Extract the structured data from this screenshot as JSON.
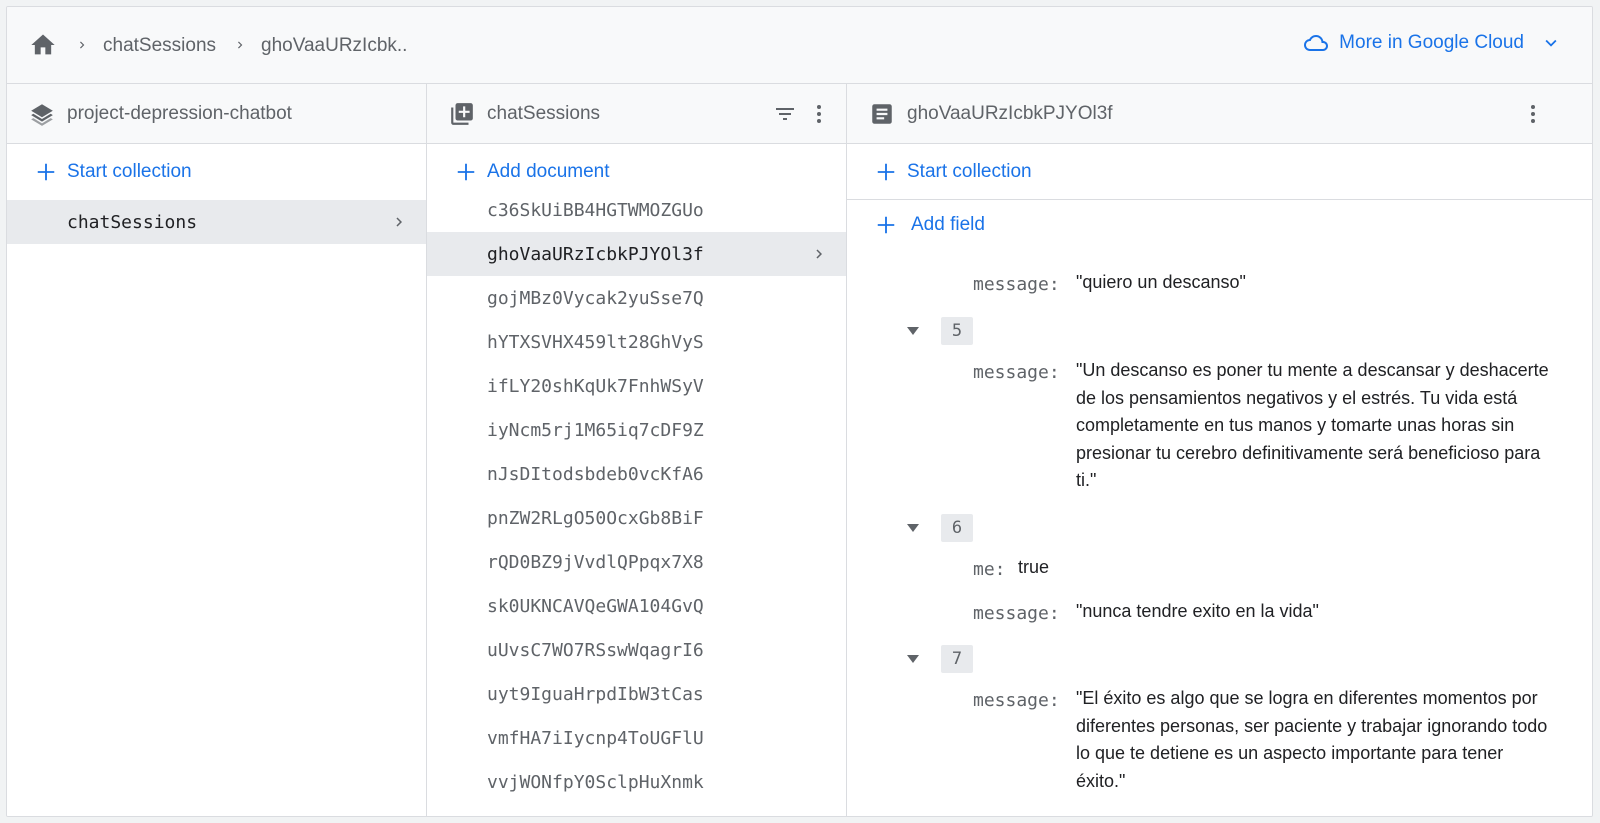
{
  "breadcrumb": {
    "items": [
      "chatSessions",
      "ghoVaaURzIcbk.."
    ],
    "gcloud_label": "More in Google Cloud"
  },
  "root_panel": {
    "title": "project-depression-chatbot",
    "action": "Start collection",
    "items": [
      "chatSessions"
    ]
  },
  "collection_panel": {
    "title": "chatSessions",
    "action": "Add document",
    "items": [
      "c36SkUiBB4HGTWMOZGUo",
      "ghoVaaURzIcbkPJYOl3f",
      "gojMBz0Vycak2yuSse7Q",
      "hYTXSVHX459lt28GhVyS",
      "ifLY20shKqUk7FnhWSyV",
      "iyNcm5rj1M65iq7cDF9Z",
      "nJsDItodsbdeb0vcKfA6",
      "pnZW2RLgO50OcxGb8BiF",
      "rQD0BZ9jVvdlQPpqx7X8",
      "sk0UKNCAVQeGWA104GvQ",
      "uUvsC7WO7RSswWqagrI6",
      "uyt9IguaHrpdIbW3tCas",
      "vmfHA7iIycnp4ToUGFlU",
      "vvjWONfpY0SclpHuXnmk"
    ]
  },
  "document_panel": {
    "title": "ghoVaaURzIcbkPJYOl3f",
    "action": "Start collection",
    "add_field": "Add field",
    "fields": {
      "msg_top_key": "message:",
      "msg_top_val": "\"quiero un descanso\"",
      "idx5": "5",
      "msg5_key": "message:",
      "msg5_val": "\"Un descanso es poner tu mente a descansar y deshacerte de los pensamientos negativos y el estrés. Tu vida está completamente en tus manos y tomarte unas horas sin presionar tu cerebro definitivamente será beneficioso para ti.\"",
      "idx6": "6",
      "me6_key": "me:",
      "me6_val": "true",
      "msg6_key": "message:",
      "msg6_val": "\"nunca tendre exito en la vida\"",
      "idx7": "7",
      "msg7_key": "message:",
      "msg7_val": "\"El éxito es algo que se logra en diferentes momentos por diferentes personas, ser paciente y trabajar ignorando todo lo que te detiene es un aspecto importante para tener éxito.\""
    }
  },
  "colors": {
    "accent": "#1a73e8",
    "selected_row": "#e8eaed",
    "muted_text": "#5f6368"
  }
}
